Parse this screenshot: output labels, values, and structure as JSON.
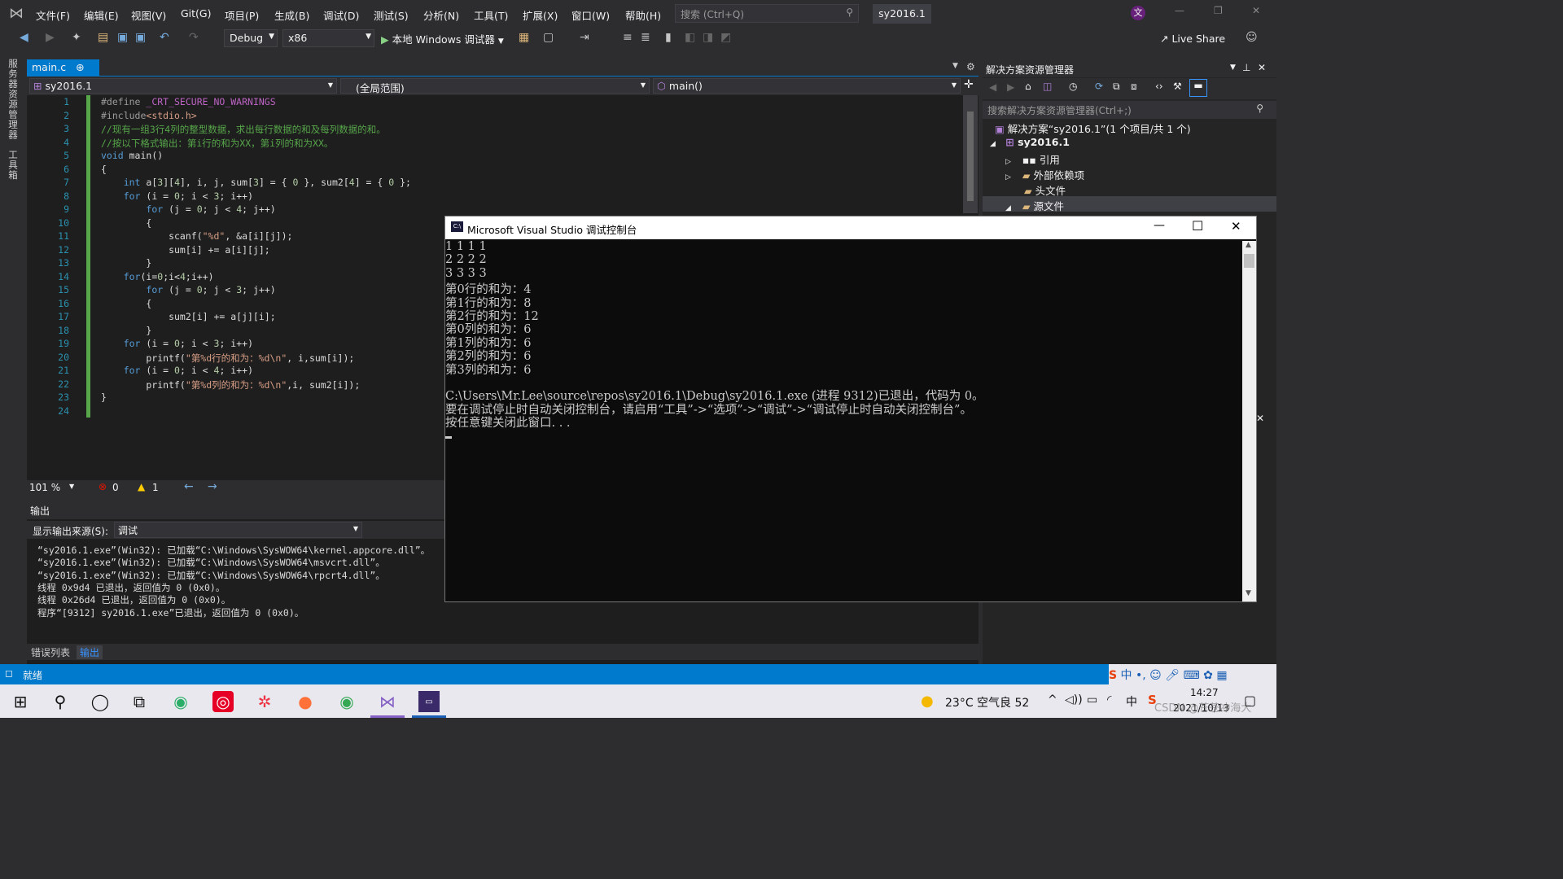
{
  "menu": [
    "文件(F)",
    "编辑(E)",
    "视图(V)",
    "Git(G)",
    "项目(P)",
    "生成(B)",
    "调试(D)",
    "测试(S)",
    "分析(N)",
    "工具(T)",
    "扩展(X)",
    "窗口(W)",
    "帮助(H)"
  ],
  "search": {
    "placeholder": "搜索 (Ctrl+Q)"
  },
  "solution_name": "sy2016.1",
  "user_badge": "文",
  "toolbar": {
    "config": "Debug",
    "platform": "x86",
    "run_label": "本地 Windows 调试器",
    "live_share": "Live Share"
  },
  "side_strip": [
    "服务器资源管理器",
    "工具箱"
  ],
  "editor": {
    "tab": "main.c",
    "project": "sy2016.1",
    "scope": "(全局范围)",
    "func": "main()",
    "zoom": "101 %",
    "errors": "0",
    "warnings": "1"
  },
  "code_lines": [
    {
      "n": "1",
      "t": "#define _CRT_SECURE_NO_WARNINGS"
    },
    {
      "n": "2",
      "t": "#include<stdio.h>"
    },
    {
      "n": "3",
      "t": "//现有一组3行4列的整型数据，求出每行数据的和及每列数据的和。"
    },
    {
      "n": "4",
      "t": "//按以下格式输出：第i行的和为XX，第i列的和为XX。"
    },
    {
      "n": "5",
      "t": "void main()"
    },
    {
      "n": "6",
      "t": "{"
    },
    {
      "n": "7",
      "t": "    int a[3][4], i, j, sum[3] = { 0 }, sum2[4] = { 0 };"
    },
    {
      "n": "8",
      "t": "    for (i = 0; i < 3; i++)"
    },
    {
      "n": "9",
      "t": "        for (j = 0; j < 4; j++)"
    },
    {
      "n": "10",
      "t": "        {"
    },
    {
      "n": "11",
      "t": "            scanf(\"%d\", &a[i][j]);"
    },
    {
      "n": "12",
      "t": "            sum[i] += a[i][j];"
    },
    {
      "n": "13",
      "t": "        }"
    },
    {
      "n": "14",
      "t": "    for(i=0;i<4;i++)"
    },
    {
      "n": "15",
      "t": "        for (j = 0; j < 3; j++)"
    },
    {
      "n": "16",
      "t": "        {"
    },
    {
      "n": "17",
      "t": "            sum2[i] += a[j][i];"
    },
    {
      "n": "18",
      "t": "        }"
    },
    {
      "n": "19",
      "t": "    for (i = 0; i < 3; i++)"
    },
    {
      "n": "20",
      "t": "        printf(\"第%d行的和为：%d\\n\", i,sum[i]);"
    },
    {
      "n": "21",
      "t": "    for (i = 0; i < 4; i++)"
    },
    {
      "n": "22",
      "t": "        printf(\"第%d列的和为：%d\\n\",i, sum2[i]);"
    },
    {
      "n": "23",
      "t": "}"
    },
    {
      "n": "24",
      "t": ""
    }
  ],
  "output": {
    "title": "输出",
    "source_label": "显示输出来源(S):",
    "source_value": "调试",
    "lines": [
      "“sy2016.1.exe”(Win32): 已加载“C:\\Windows\\SysWOW64\\kernel.appcore.dll”。",
      "“sy2016.1.exe”(Win32): 已加载“C:\\Windows\\SysWOW64\\msvcrt.dll”。",
      "“sy2016.1.exe”(Win32): 已加载“C:\\Windows\\SysWOW64\\rpcrt4.dll”。",
      "线程 0x9d4 已退出，返回值为 0 (0x0)。",
      "线程 0x26d4 已退出，返回值为 0 (0x0)。",
      "程序“[9312] sy2016.1.exe”已退出，返回值为 0 (0x0)。"
    ],
    "tabs": [
      "错误列表",
      "输出"
    ]
  },
  "solution_explorer": {
    "title": "解决方案资源管理器",
    "search": "搜索解决方案资源管理器(Ctrl+;)",
    "root": "解决方案“sy2016.1”(1 个项目/共 1 个)",
    "project": "sy2016.1",
    "items": [
      "引用",
      "外部依赖项",
      "头文件",
      "源文件"
    ]
  },
  "console": {
    "title": "Microsoft Visual Studio 调试控制台",
    "lines": [
      "1 1 1 1",
      "2 2 2 2",
      "3 3 3 3",
      "第0行的和为：4",
      "第1行的和为：8",
      "第2行的和为：12",
      "第0列的和为：6",
      "第1列的和为：6",
      "第2列的和为：6",
      "第3列的和为：6",
      "",
      "C:\\Users\\Mr.Lee\\source\\repos\\sy2016.1\\Debug\\sy2016.1.exe (进程 9312)已退出，代码为 0。",
      "要在调试停止时自动关闭控制台，请启用“工具”->“选项”->“调试”->“调试停止时自动关闭控制台”。",
      "按任意键关闭此窗口. . ."
    ]
  },
  "status": {
    "ready": "就绪"
  },
  "taskbar": {
    "weather": "23°C 空气良 52",
    "time": "14:27",
    "date": "2021/10/13",
    "ime": "中",
    "watermark": "CSDN @苍苍冲海大"
  }
}
